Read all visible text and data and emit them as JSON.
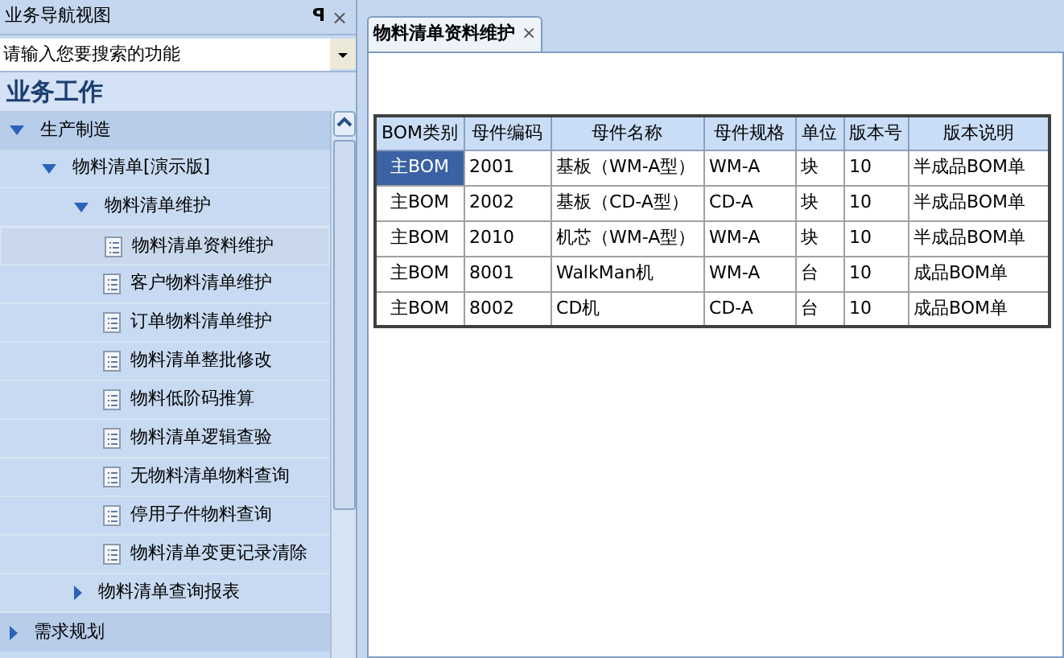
{
  "nav_panel": {
    "title": "业务导航视图",
    "pin": "ꟼ",
    "close": "×",
    "search": {
      "placeholder": "请输入您要搜索的功能"
    },
    "section_title": "业务工作",
    "tree": [
      {
        "label": "生产制造",
        "kind": "folder",
        "expanded": true,
        "children": [
          {
            "label": "物料清单[演示版]",
            "kind": "folder",
            "expanded": true,
            "children": [
              {
                "label": "物料清单维护",
                "kind": "folder",
                "expanded": true,
                "children": [
                  {
                    "label": "物料清单资料维护",
                    "kind": "leaf",
                    "selected": true
                  },
                  {
                    "label": "客户物料清单维护",
                    "kind": "leaf",
                    "selected": false
                  },
                  {
                    "label": "订单物料清单维护",
                    "kind": "leaf",
                    "selected": false
                  },
                  {
                    "label": "物料清单整批修改",
                    "kind": "leaf",
                    "selected": false
                  },
                  {
                    "label": "物料低阶码推算",
                    "kind": "leaf",
                    "selected": false
                  },
                  {
                    "label": "物料清单逻辑查验",
                    "kind": "leaf",
                    "selected": false
                  },
                  {
                    "label": "无物料清单物料查询",
                    "kind": "leaf",
                    "selected": false
                  },
                  {
                    "label": "停用子件物料查询",
                    "kind": "leaf",
                    "selected": false
                  },
                  {
                    "label": "物料清单变更记录清除",
                    "kind": "leaf",
                    "selected": false
                  }
                ]
              },
              {
                "label": "物料清单查询报表",
                "kind": "folder",
                "expanded": false
              }
            ]
          }
        ]
      },
      {
        "label": "需求规划",
        "kind": "folder",
        "expanded": false
      }
    ]
  },
  "tabs": [
    {
      "label": "物料清单资料维护",
      "close": "×",
      "selected": true
    }
  ],
  "table": {
    "columns": [
      "BOM类别",
      "母件编码",
      "母件名称",
      "母件规格",
      "单位",
      "版本号",
      "版本说明"
    ],
    "rows": [
      {
        "selected": true,
        "cells": [
          "主BOM",
          "2001",
          "基板（WM-A型）",
          "WM-A",
          "块",
          "10",
          "半成品BOM单"
        ]
      },
      {
        "selected": false,
        "cells": [
          "主BOM",
          "2002",
          "基板（CD-A型）",
          "CD-A",
          "块",
          "10",
          "半成品BOM单"
        ]
      },
      {
        "selected": false,
        "cells": [
          "主BOM",
          "2010",
          "机芯（WM-A型）",
          "WM-A",
          "块",
          "10",
          "半成品BOM单"
        ]
      },
      {
        "selected": false,
        "cells": [
          "主BOM",
          "8001",
          "WalkMan机",
          "WM-A",
          "台",
          "10",
          "成品BOM单"
        ]
      },
      {
        "selected": false,
        "cells": [
          "主BOM",
          "8002",
          "CD机",
          "CD-A",
          "台",
          "10",
          "成品BOM单"
        ]
      }
    ]
  }
}
